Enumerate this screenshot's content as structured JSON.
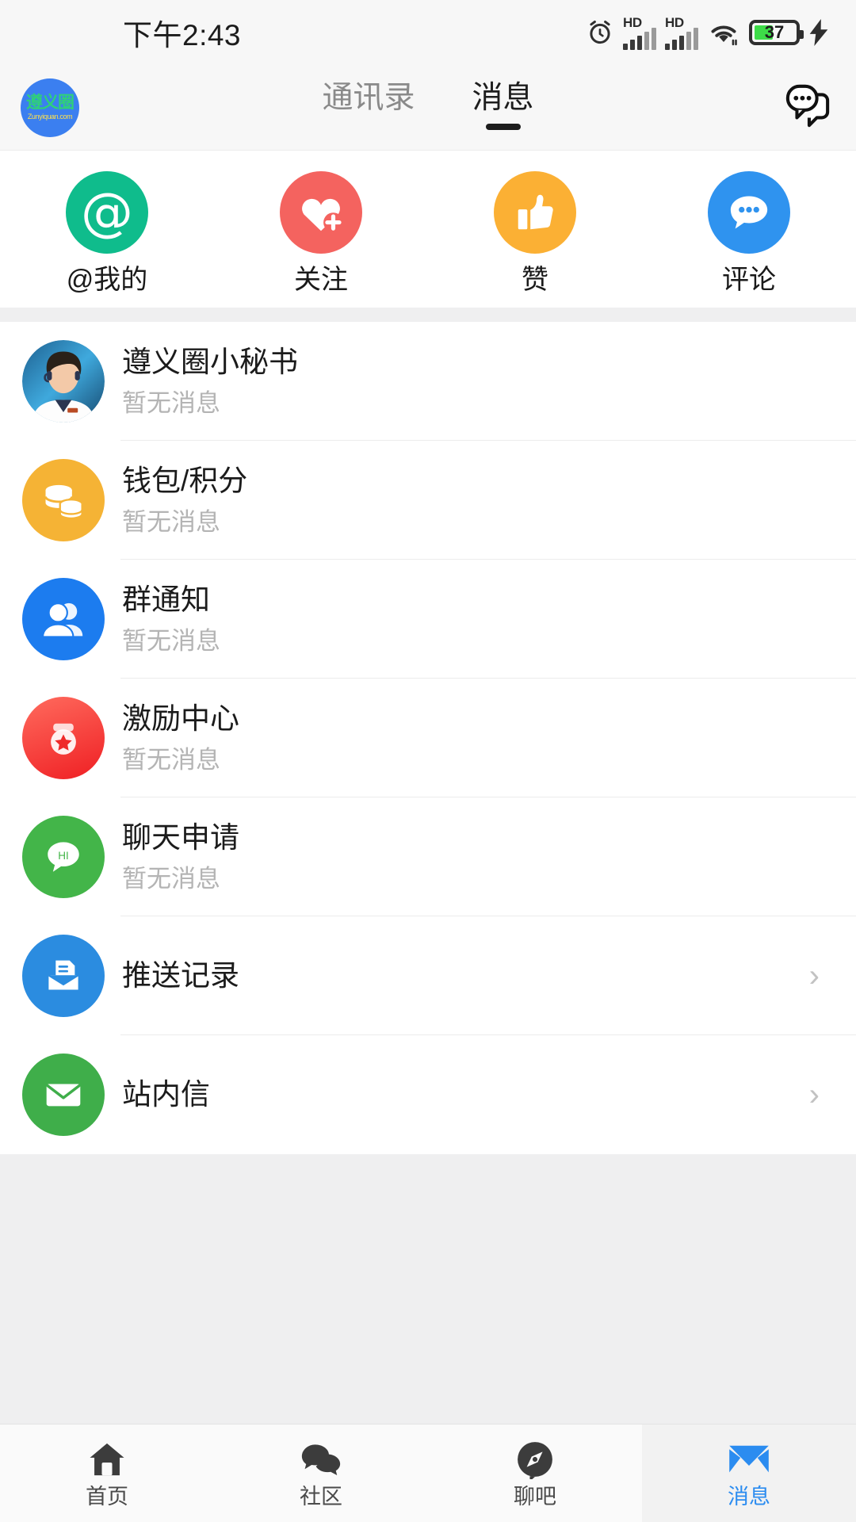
{
  "status_bar": {
    "time": "下午2:43",
    "alarm_icon": "alarm-clock-icon",
    "sim1_label": "HD",
    "sim2_label": "HD",
    "wifi_icon": "wifi-icon",
    "battery_percent": "37",
    "battery_color": "#3ddc48",
    "charging_icon": "lightning-bolt-icon"
  },
  "nav": {
    "logo": {
      "name": "zunyiquan-logo",
      "cn": "遵义圈",
      "en": "Zunyiquan.com"
    },
    "tabs": [
      {
        "label": "通讯录",
        "active": false
      },
      {
        "label": "消息",
        "active": true
      }
    ],
    "action_icon": "chat-bubbles-icon"
  },
  "quick_actions": [
    {
      "label": "@我的",
      "icon": "at-mention-icon",
      "color": "#0fbc8c"
    },
    {
      "label": "关注",
      "icon": "heart-plus-icon",
      "color": "#f4635f"
    },
    {
      "label": "赞",
      "icon": "thumbs-up-icon",
      "color": "#fbb034"
    },
    {
      "label": "评论",
      "icon": "comment-bubble-icon",
      "color": "#2f93ef"
    }
  ],
  "message_list": [
    {
      "title": "遵义圈小秘书",
      "subtitle": "暂无消息",
      "icon": "customer-service-avatar",
      "color": "#2e86c1",
      "chevron": false,
      "has_sub": true
    },
    {
      "title": "钱包/积分",
      "subtitle": "暂无消息",
      "icon": "coins-stack-icon",
      "color": "#f5b335",
      "chevron": false,
      "has_sub": true
    },
    {
      "title": "群通知",
      "subtitle": "暂无消息",
      "icon": "group-users-icon",
      "color": "#1c7cef",
      "chevron": false,
      "has_sub": true
    },
    {
      "title": "激励中心",
      "subtitle": "暂无消息",
      "icon": "medal-star-icon",
      "color": "#f03b3b",
      "chevron": false,
      "has_sub": true
    },
    {
      "title": "聊天申请",
      "subtitle": "暂无消息",
      "icon": "hi-bubble-icon",
      "color": "#43b549",
      "chevron": false,
      "has_sub": true
    },
    {
      "title": "推送记录",
      "subtitle": "",
      "icon": "inbox-document-icon",
      "color": "#2b8ce0",
      "chevron": true,
      "has_sub": false
    },
    {
      "title": "站内信",
      "subtitle": "",
      "icon": "envelope-icon",
      "color": "#3fae4a",
      "chevron": true,
      "has_sub": false
    }
  ],
  "chevron_glyph": "›",
  "tabbar": [
    {
      "label": "首页",
      "icon": "home-icon",
      "active": false
    },
    {
      "label": "社区",
      "icon": "community-chat-icon",
      "active": false
    },
    {
      "label": "聊吧",
      "icon": "compass-chat-icon",
      "active": false
    },
    {
      "label": "消息",
      "icon": "paper-plane-icon",
      "active": true
    }
  ],
  "colors": {
    "accent": "#2b8cf0",
    "page_bg": "#efeff0",
    "card_bg": "#ffffff"
  }
}
